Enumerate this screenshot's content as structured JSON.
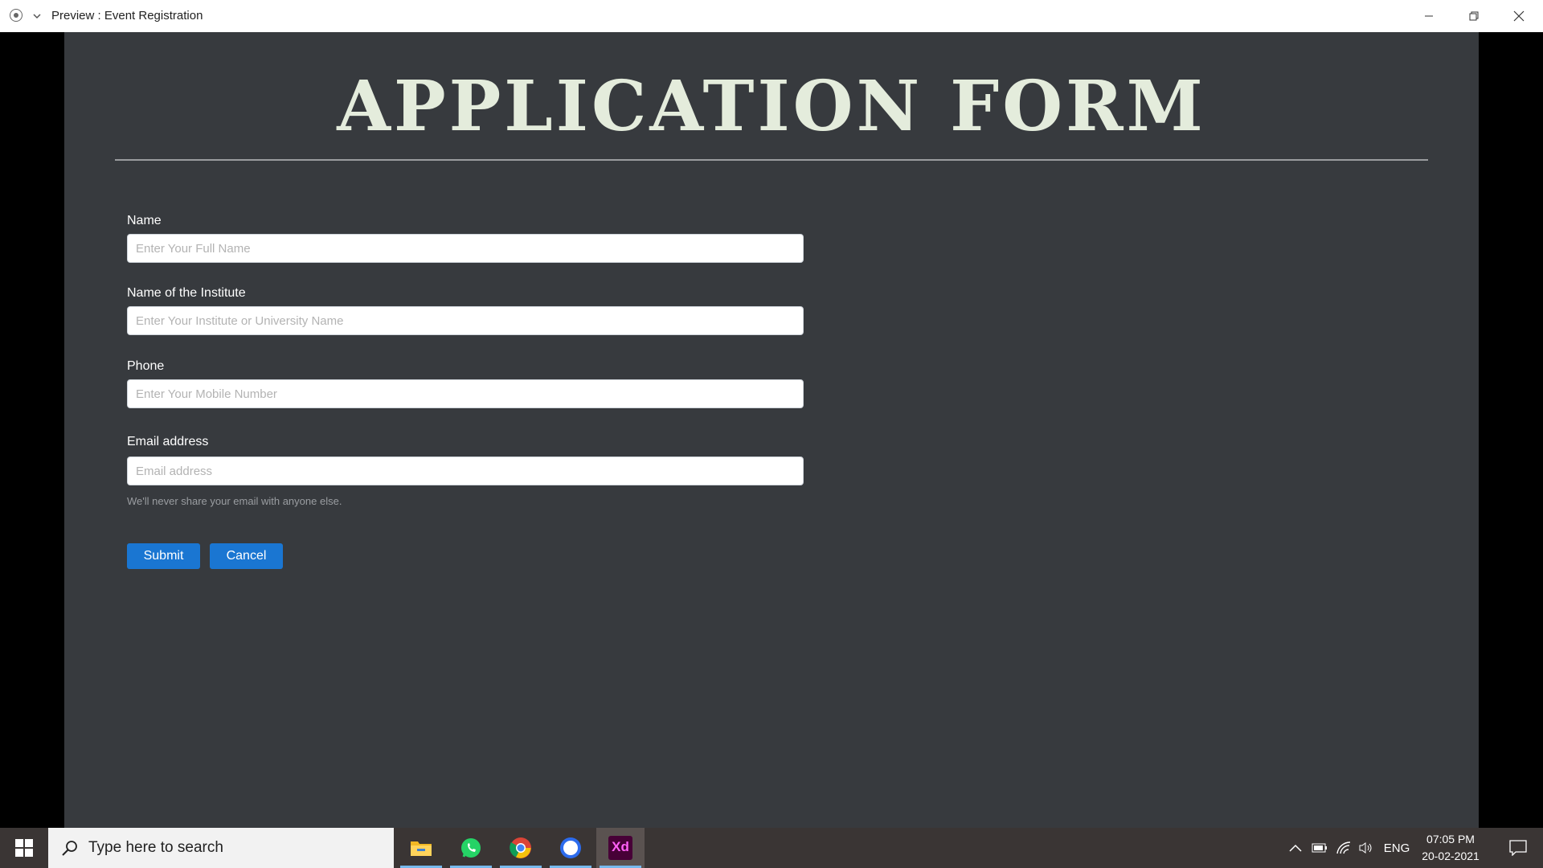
{
  "window": {
    "title": "Preview : Event Registration"
  },
  "form": {
    "title": "APPLICATION FORM",
    "fields": [
      {
        "label": "Name",
        "placeholder": "Enter Your Full Name",
        "value": ""
      },
      {
        "label": "Name of the Institute",
        "placeholder": "Enter Your Institute or University Name",
        "value": ""
      },
      {
        "label": "Phone",
        "placeholder": "Enter Your Mobile Number",
        "value": ""
      },
      {
        "label": "Email address",
        "placeholder": "Email address",
        "value": ""
      }
    ],
    "email_help": "We'll never share your email with anyone else.",
    "submit_label": "Submit",
    "cancel_label": "Cancel",
    "accent_color": "#1a76d2",
    "background_color": "#373a3e"
  },
  "taskbar": {
    "search_placeholder": "Type here to search",
    "apps": [
      "file-explorer-icon",
      "whatsapp-icon",
      "chrome-icon",
      "signal-icon",
      "adobe-xd-icon"
    ],
    "xd_label": "Xd",
    "language": "ENG",
    "time": "07:05 PM",
    "date": "20-02-2021"
  }
}
